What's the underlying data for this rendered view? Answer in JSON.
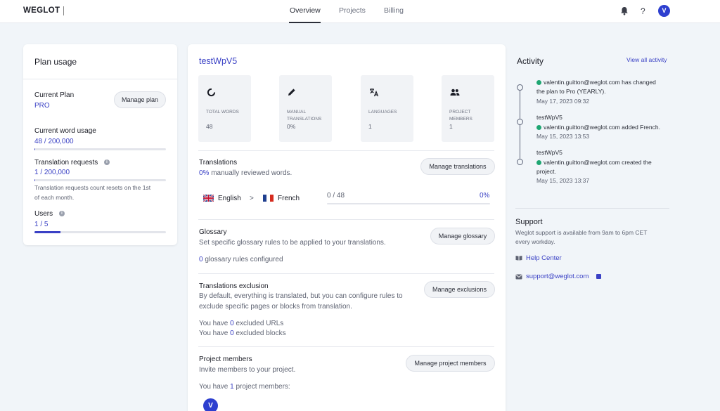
{
  "topbar": {
    "logo": "WEGLOT",
    "tabs": [
      {
        "label": "Overview",
        "active": true
      },
      {
        "label": "Projects",
        "active": false
      },
      {
        "label": "Billing",
        "active": false
      }
    ],
    "help_symbol": "?",
    "avatar_initial": "V"
  },
  "plan_usage": {
    "title": "Plan usage",
    "current_plan_label": "Current Plan",
    "current_plan_value": "PRO",
    "manage_plan_button": "Manage plan",
    "word_usage_label": "Current word usage",
    "word_usage_value": "48 / 200,000",
    "word_usage_fraction": 0.00024,
    "requests_label": "Translation requests",
    "requests_value": "1 / 200,000",
    "requests_fraction": 5e-06,
    "requests_note_line1": "Translation requests count resets on the 1st",
    "requests_note_line2": "of each month.",
    "users_label": "Users",
    "users_value": "1 / 5",
    "users_fraction": 0.2
  },
  "project": {
    "name": "testWpV5",
    "stats": [
      {
        "icon": "loader-icon",
        "label": "TOTAL WORDS",
        "value": "48"
      },
      {
        "icon": "pencil-icon",
        "label": "MANUAL TRANSLATIONS",
        "value": "0%"
      },
      {
        "icon": "translate-icon",
        "label": "LANGUAGES",
        "value": "1"
      },
      {
        "icon": "people-icon",
        "label": "PROJECT MEMBERS",
        "value": "1"
      }
    ],
    "translations": {
      "title": "Translations",
      "pct": "0%",
      "reviewed_text": " manually reviewed words.",
      "button": "Manage translations",
      "source_lang": "English",
      "target_lang": "French",
      "arrow": ">",
      "count": "0 / 48",
      "progress_pct": "0%"
    },
    "glossary": {
      "title": "Glossary",
      "desc": "Set specific glossary rules to be applied to your translations.",
      "button": "Manage glossary",
      "count": "0",
      "count_text": " glossary rules configured"
    },
    "exclusion": {
      "title": "Translations exclusion",
      "desc_line1": "By default, everything is translated, but you can configure rules to",
      "desc_line2": "exclude specific pages or blocks from translation.",
      "button": "Manage exclusions",
      "urls_prefix": "You have ",
      "urls_count": "0",
      "urls_suffix": " excluded URLs",
      "blocks_prefix": "You have ",
      "blocks_count": "0",
      "blocks_suffix": " excluded blocks"
    },
    "members": {
      "title": "Project members",
      "desc": "Invite members to your project.",
      "button": "Manage project members",
      "count_prefix": "You have ",
      "count": "1",
      "count_suffix": " project members:",
      "avatar_initial": "V"
    }
  },
  "activity": {
    "title": "Activity",
    "view_all": "View all activity",
    "items": [
      {
        "project": "",
        "line1": "valentin.guitton@weglot.com has changed",
        "line2": "the plan to Pro (YEARLY).",
        "date": "May 17, 2023 09:32"
      },
      {
        "project": "testWpV5",
        "line1": "valentin.guitton@weglot.com added French.",
        "line2": "",
        "date": "May 15, 2023 13:53"
      },
      {
        "project": "testWpV5",
        "line1": "valentin.guitton@weglot.com created the",
        "line2": "project.",
        "date": "May 15, 2023 13:37"
      }
    ]
  },
  "support": {
    "title": "Support",
    "desc_line1": "Weglot support is available from 9am to 6pm CET",
    "desc_line2": "every workday.",
    "help_center": "Help Center",
    "email": "support@weglot.com"
  },
  "colors": {
    "accent": "#3a41c5",
    "success": "#1ea672",
    "avatar": "#2d3fcf"
  }
}
